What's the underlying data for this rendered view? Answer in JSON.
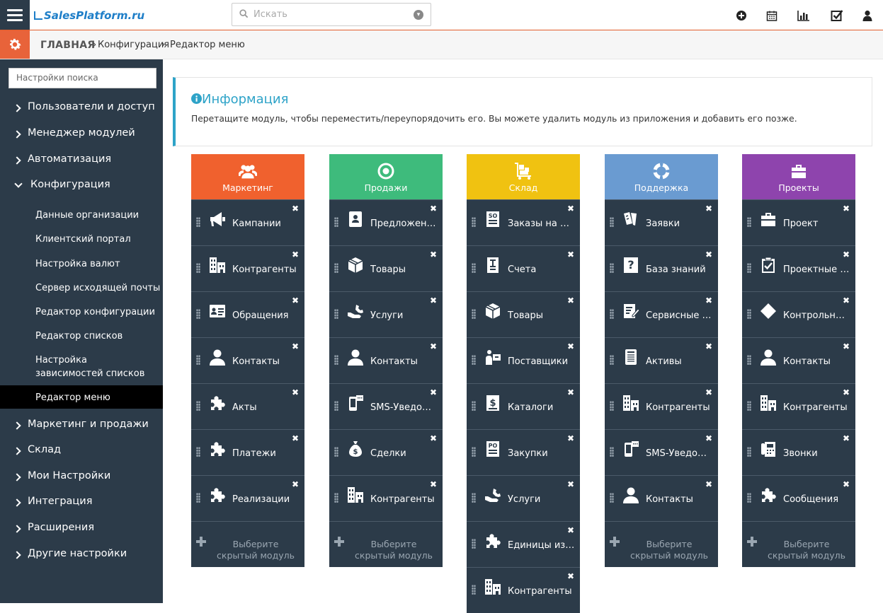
{
  "header": {
    "logo": "SalesPlatform.ru",
    "search_placeholder": "Искать"
  },
  "breadcrumb": {
    "home": "ГЛАВНАЯ",
    "level1": "Конфигурация",
    "level2": "Редактор меню"
  },
  "sidebar": {
    "search_placeholder": "Настройки поиска",
    "items": [
      {
        "label": "Пользователи и доступ"
      },
      {
        "label": "Менеджер модулей"
      },
      {
        "label": "Автоматизация"
      },
      {
        "label": "Конфигурация"
      },
      {
        "label": "Маркетинг и продажи"
      },
      {
        "label": "Склад"
      },
      {
        "label": "Мои Настройки"
      },
      {
        "label": "Интеграция"
      },
      {
        "label": "Расширения"
      },
      {
        "label": "Другие настройки"
      }
    ],
    "sub_items": [
      {
        "label": "Данные организации"
      },
      {
        "label": "Клиентский портал"
      },
      {
        "label": "Настройка валют"
      },
      {
        "label": "Сервер исходящей почты"
      },
      {
        "label": "Редактор конфигурации"
      },
      {
        "label": "Редактор списков"
      },
      {
        "label": "Настройка зависимостей списков"
      },
      {
        "label": "Редактор меню"
      }
    ]
  },
  "info": {
    "title": "Информация",
    "text": "Перетащите модуль, чтобы переместить/переупорядочить его. Вы можете удалить модуль из приложения и добавить его позже."
  },
  "hidden_label": "Выберите скрытый модуль",
  "columns": [
    {
      "title": "Маркетинг",
      "color": "#f0612e",
      "icon": "users-group-icon",
      "modules": [
        {
          "label": "Кампании",
          "icon": "megaphone-icon"
        },
        {
          "label": "Контрагенты",
          "icon": "building-icon"
        },
        {
          "label": "Обращения",
          "icon": "id-card-icon"
        },
        {
          "label": "Контакты",
          "icon": "person-icon"
        },
        {
          "label": "Акты",
          "icon": "puzzle-icon"
        },
        {
          "label": "Платежи",
          "icon": "puzzle-icon"
        },
        {
          "label": "Реализации",
          "icon": "puzzle-icon"
        }
      ]
    },
    {
      "title": "Продажи",
      "color": "#3ebb7c",
      "icon": "target-icon",
      "modules": [
        {
          "label": "Предложения",
          "icon": "badge-icon"
        },
        {
          "label": "Товары",
          "icon": "box-icon"
        },
        {
          "label": "Услуги",
          "icon": "hand-wrench-icon"
        },
        {
          "label": "Контакты",
          "icon": "person-icon"
        },
        {
          "label": "SMS-Уведомления",
          "icon": "sms-phone-icon"
        },
        {
          "label": "Сделки",
          "icon": "money-bag-icon"
        },
        {
          "label": "Контрагенты",
          "icon": "building-icon"
        }
      ]
    },
    {
      "title": "Склад",
      "color": "#f0c211",
      "icon": "cart-boxes-icon",
      "modules": [
        {
          "label": "Заказы на продажу",
          "icon": "so-doc-icon"
        },
        {
          "label": "Счета",
          "icon": "invoice-icon"
        },
        {
          "label": "Товары",
          "icon": "box-icon"
        },
        {
          "label": "Поставщики",
          "icon": "vendor-icon"
        },
        {
          "label": "Каталоги",
          "icon": "pricebook-icon"
        },
        {
          "label": "Закупки",
          "icon": "po-doc-icon"
        },
        {
          "label": "Услуги",
          "icon": "hand-wrench-icon"
        },
        {
          "label": "Единицы измерения",
          "icon": "puzzle-icon"
        },
        {
          "label": "Контрагенты",
          "icon": "building-icon"
        }
      ]
    },
    {
      "title": "Поддержка",
      "color": "#6a9bd1",
      "icon": "lifebuoy-icon",
      "modules": [
        {
          "label": "Заявки",
          "icon": "tickets-icon"
        },
        {
          "label": "База знаний",
          "icon": "question-book-icon"
        },
        {
          "label": "Сервисные контракты",
          "icon": "edit-doc-icon"
        },
        {
          "label": "Активы",
          "icon": "assets-icon"
        },
        {
          "label": "Контрагенты",
          "icon": "building-icon"
        },
        {
          "label": "SMS-Уведомления",
          "icon": "sms-phone-icon"
        },
        {
          "label": "Контакты",
          "icon": "person-icon"
        }
      ]
    },
    {
      "title": "Проекты",
      "color": "#8e44ad",
      "icon": "briefcase-icon",
      "modules": [
        {
          "label": "Проект",
          "icon": "briefcase-icon"
        },
        {
          "label": "Проектные задачи",
          "icon": "clipboard-check-icon"
        },
        {
          "label": "Контрольные точки",
          "icon": "diamond-icon"
        },
        {
          "label": "Контакты",
          "icon": "person-icon"
        },
        {
          "label": "Контрагенты",
          "icon": "building-icon"
        },
        {
          "label": "Звонки",
          "icon": "phone-book-icon"
        },
        {
          "label": "Сообщения",
          "icon": "puzzle-icon"
        }
      ]
    }
  ]
}
